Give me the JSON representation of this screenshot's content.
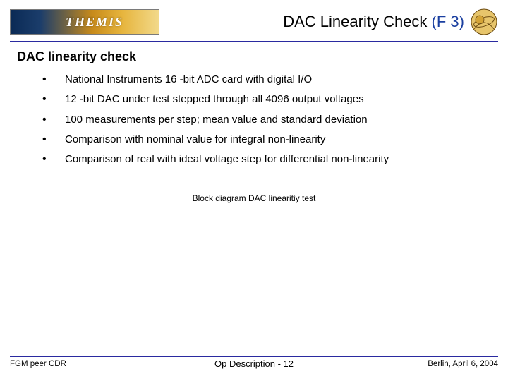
{
  "header": {
    "logo_text": "THEMIS",
    "title_main": "DAC Linearity Check ",
    "title_code": "(F 3)"
  },
  "section": {
    "heading": "DAC linearity check",
    "bullets": [
      "National Instruments 16 -bit ADC card with digital I/O",
      "12 -bit DAC under test stepped through all 4096 output voltages",
      "100 measurements per step; mean value and standard deviation",
      "Comparison with nominal value for integral non-linearity",
      "Comparison of real with ideal voltage step for differential non-linearity"
    ]
  },
  "diagram_caption": "Block diagram DAC linearitiy test",
  "footer": {
    "left": "FGM peer CDR",
    "center": "Op Description - 12",
    "right": "Berlin, April 6, 2004"
  }
}
